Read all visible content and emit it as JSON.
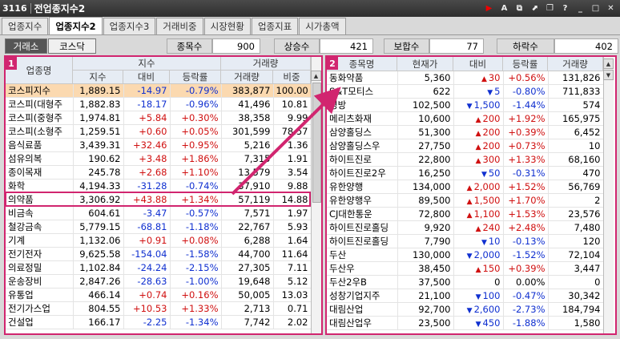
{
  "window": {
    "code": "3116",
    "title": "전업종지수2"
  },
  "tabs": [
    "업종지수",
    "업종지수2",
    "업종지수3",
    "거래비중",
    "시장현황",
    "업종지표",
    "시가총액"
  ],
  "market_buttons": [
    "거래소",
    "코스닥"
  ],
  "stats": [
    {
      "label": "종목수",
      "value": "900"
    },
    {
      "label": "상승수",
      "value": "421"
    },
    {
      "label": "보합수",
      "value": "77"
    },
    {
      "label": "하락수",
      "value": "402"
    }
  ],
  "left": {
    "badge": "1",
    "headers": {
      "name": "업종명",
      "index_group": "지수",
      "volume_group": "거래량",
      "index": "지수",
      "change": "대비",
      "rate": "등락률",
      "volume": "거래량",
      "share": "비중"
    },
    "rows": [
      {
        "name": "코스피지수",
        "index": "1,889.15",
        "change": "-14.97",
        "rate": "-0.79%",
        "volume": "383,877",
        "share": "100.00",
        "dir": "dn"
      },
      {
        "name": "코스피(대형주",
        "index": "1,882.83",
        "change": "-18.17",
        "rate": "-0.96%",
        "volume": "41,496",
        "share": "10.81",
        "dir": "dn"
      },
      {
        "name": "코스피(중형주",
        "index": "1,974.81",
        "change": "+5.84",
        "rate": "+0.30%",
        "volume": "38,358",
        "share": "9.99",
        "dir": "up"
      },
      {
        "name": "코스피(소형주",
        "index": "1,259.51",
        "change": "+0.60",
        "rate": "+0.05%",
        "volume": "301,599",
        "share": "78.57",
        "dir": "up"
      },
      {
        "name": "음식료품",
        "index": "3,439.31",
        "change": "+32.46",
        "rate": "+0.95%",
        "volume": "5,216",
        "share": "1.36",
        "dir": "up"
      },
      {
        "name": "섬유의복",
        "index": "190.62",
        "change": "+3.48",
        "rate": "+1.86%",
        "volume": "7,315",
        "share": "1.91",
        "dir": "up"
      },
      {
        "name": "종이목재",
        "index": "245.78",
        "change": "+2.68",
        "rate": "+1.10%",
        "volume": "13,579",
        "share": "3.54",
        "dir": "up"
      },
      {
        "name": "화학",
        "index": "4,194.33",
        "change": "-31.28",
        "rate": "-0.74%",
        "volume": "37,910",
        "share": "9.88",
        "dir": "dn"
      },
      {
        "name": "의약품",
        "index": "3,306.92",
        "change": "+43.88",
        "rate": "+1.34%",
        "volume": "57,119",
        "share": "14.88",
        "dir": "up"
      },
      {
        "name": "비금속",
        "index": "604.61",
        "change": "-3.47",
        "rate": "-0.57%",
        "volume": "7,571",
        "share": "1.97",
        "dir": "dn"
      },
      {
        "name": "철강금속",
        "index": "5,779.15",
        "change": "-68.81",
        "rate": "-1.18%",
        "volume": "22,767",
        "share": "5.93",
        "dir": "dn"
      },
      {
        "name": "기계",
        "index": "1,132.06",
        "change": "+0.91",
        "rate": "+0.08%",
        "volume": "6,288",
        "share": "1.64",
        "dir": "up"
      },
      {
        "name": "전기전자",
        "index": "9,625.58",
        "change": "-154.04",
        "rate": "-1.58%",
        "volume": "44,700",
        "share": "11.64",
        "dir": "dn"
      },
      {
        "name": "의료정밀",
        "index": "1,102.84",
        "change": "-24.24",
        "rate": "-2.15%",
        "volume": "27,305",
        "share": "7.11",
        "dir": "dn"
      },
      {
        "name": "운송장비",
        "index": "2,847.26",
        "change": "-28.63",
        "rate": "-1.00%",
        "volume": "19,648",
        "share": "5.12",
        "dir": "dn"
      },
      {
        "name": "유통업",
        "index": "466.14",
        "change": "+0.74",
        "rate": "+0.16%",
        "volume": "50,005",
        "share": "13.03",
        "dir": "up"
      },
      {
        "name": "전기가스업",
        "index": "804.55",
        "change": "+10.53",
        "rate": "+1.33%",
        "volume": "2,713",
        "share": "0.71",
        "dir": "up"
      },
      {
        "name": "건설업",
        "index": "166.17",
        "change": "-2.25",
        "rate": "-1.34%",
        "volume": "7,742",
        "share": "2.02",
        "dir": "dn"
      }
    ]
  },
  "right": {
    "badge": "2",
    "headers": {
      "name": "종목명",
      "price": "현재가",
      "change": "대비",
      "rate": "등락률",
      "volume": "거래량"
    },
    "rows": [
      {
        "name": "동화약품",
        "price": "5,360",
        "change": "30",
        "rate": "+0.56%",
        "volume": "131,826",
        "dir": "up"
      },
      {
        "name": "S&T모티스",
        "price": "622",
        "change": "5",
        "rate": "-0.80%",
        "volume": "711,833",
        "dir": "dn"
      },
      {
        "name": "경방",
        "price": "102,500",
        "change": "1,500",
        "rate": "-1.44%",
        "volume": "574",
        "dir": "dn"
      },
      {
        "name": "메리츠화재",
        "price": "10,600",
        "change": "200",
        "rate": "+1.92%",
        "volume": "165,975",
        "dir": "up"
      },
      {
        "name": "삼양홀딩스",
        "price": "51,300",
        "change": "200",
        "rate": "+0.39%",
        "volume": "6,452",
        "dir": "up"
      },
      {
        "name": "삼양홀딩스우",
        "price": "27,750",
        "change": "200",
        "rate": "+0.73%",
        "volume": "10",
        "dir": "up"
      },
      {
        "name": "하이트진로",
        "price": "22,800",
        "change": "300",
        "rate": "+1.33%",
        "volume": "68,160",
        "dir": "up"
      },
      {
        "name": "하이트진로2우",
        "price": "16,250",
        "change": "50",
        "rate": "-0.31%",
        "volume": "470",
        "dir": "dn"
      },
      {
        "name": "유한양행",
        "price": "134,000",
        "change": "2,000",
        "rate": "+1.52%",
        "volume": "56,769",
        "dir": "up"
      },
      {
        "name": "유한양행우",
        "price": "89,500",
        "change": "1,500",
        "rate": "+1.70%",
        "volume": "2",
        "dir": "up"
      },
      {
        "name": "CJ대한통운",
        "price": "72,800",
        "change": "1,100",
        "rate": "+1.53%",
        "volume": "23,576",
        "dir": "up"
      },
      {
        "name": "하이트진로홀딩",
        "price": "9,920",
        "change": "240",
        "rate": "+2.48%",
        "volume": "7,480",
        "dir": "up"
      },
      {
        "name": "하이트진로홀딩",
        "price": "7,790",
        "change": "10",
        "rate": "-0.13%",
        "volume": "120",
        "dir": "dn"
      },
      {
        "name": "두산",
        "price": "130,000",
        "change": "2,000",
        "rate": "-1.52%",
        "volume": "72,104",
        "dir": "dn"
      },
      {
        "name": "두산우",
        "price": "38,450",
        "change": "150",
        "rate": "+0.39%",
        "volume": "3,447",
        "dir": "up"
      },
      {
        "name": "두산2우B",
        "price": "37,500",
        "change": "0",
        "rate": "0.00%",
        "volume": "0",
        "dir": "flat"
      },
      {
        "name": "성창기업지주",
        "price": "21,100",
        "change": "100",
        "rate": "-0.47%",
        "volume": "30,342",
        "dir": "dn"
      },
      {
        "name": "대림산업",
        "price": "92,700",
        "change": "2,600",
        "rate": "-2.73%",
        "volume": "184,794",
        "dir": "dn"
      },
      {
        "name": "대림산업우",
        "price": "23,500",
        "change": "450",
        "rate": "-1.88%",
        "volume": "1,580",
        "dir": "dn"
      }
    ]
  },
  "colors": {
    "accent": "#d1256f",
    "up": "#d01010",
    "down": "#1030d0",
    "highlight_row": "#fbd9b0",
    "header_bg": "#e6ecf4"
  }
}
